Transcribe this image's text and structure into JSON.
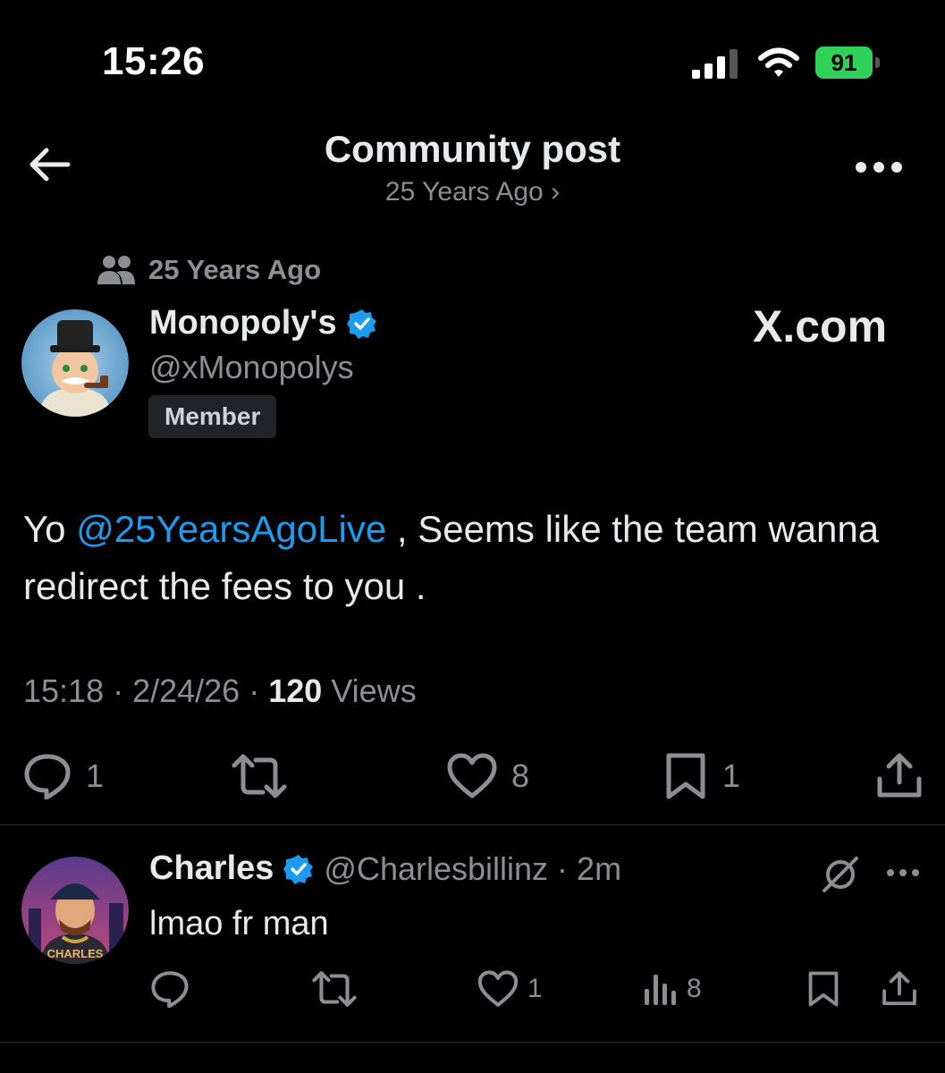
{
  "status_bar": {
    "time": "15:26",
    "battery": "91"
  },
  "header": {
    "title": "Community post",
    "subtitle": "25 Years Ago ›"
  },
  "community": {
    "name": "25 Years Ago"
  },
  "post": {
    "display_name": "Monopoly's",
    "handle": "@xMonopolys",
    "badge": "Member",
    "brand": "X.com",
    "text_prefix": "Yo ",
    "mention": "@25YearsAgoLive",
    "text_suffix": " , Seems like the team wanna redirect the fees to you .",
    "time": "15:18",
    "date": "2/24/26",
    "views_count": "120",
    "views_label": "Views",
    "replies": "1",
    "likes": "8",
    "bookmarks": "1"
  },
  "reply": {
    "display_name": "Charles",
    "handle": "@Charlesbillinz",
    "age": "2m",
    "text": "lmao fr man",
    "likes": "1",
    "views": "8",
    "avatar_label": "CHARLES"
  },
  "colors": {
    "accent": "#1d9bf0",
    "battery": "#30d158",
    "background": "#000000"
  }
}
